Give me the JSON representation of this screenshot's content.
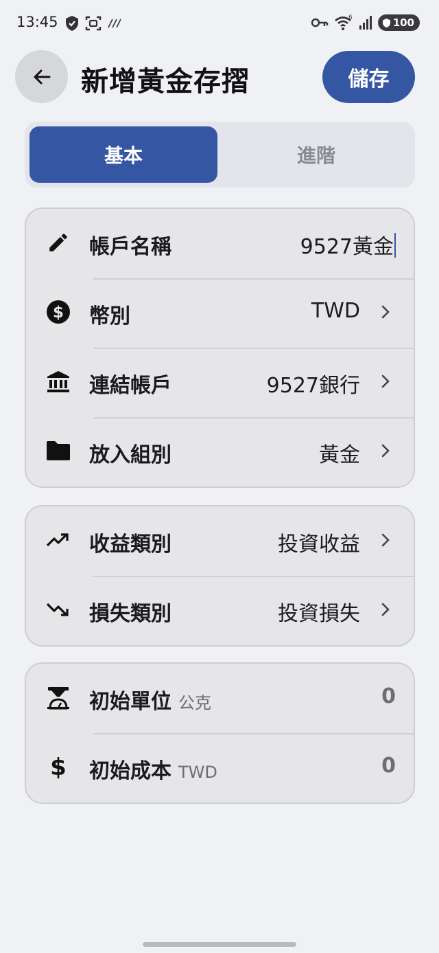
{
  "status_bar": {
    "time": "13:45",
    "battery": "100",
    "wifi_badge": "6"
  },
  "header": {
    "title": "新增黃金存摺",
    "save_label": "儲存"
  },
  "tabs": [
    {
      "label": "基本",
      "active": true
    },
    {
      "label": "進階",
      "active": false
    }
  ],
  "account_section": {
    "name": {
      "label": "帳戶名稱",
      "value": "9527黃金",
      "icon": "pencil-icon"
    },
    "currency": {
      "label": "幣別",
      "value": "TWD",
      "icon": "dollar-circle-icon"
    },
    "linked_account": {
      "label": "連結帳戶",
      "value": "9527銀行",
      "icon": "bank-icon"
    },
    "group": {
      "label": "放入組別",
      "value": "黃金",
      "icon": "folder-icon"
    }
  },
  "category_section": {
    "income": {
      "label": "收益類別",
      "value": "投資收益",
      "icon": "trending-up-icon"
    },
    "loss": {
      "label": "損失類別",
      "value": "投資損失",
      "icon": "trending-down-icon"
    }
  },
  "initial_section": {
    "units": {
      "label": "初始單位",
      "unit": "公克",
      "value": "0",
      "icon": "scale-icon"
    },
    "cost": {
      "label": "初始成本",
      "unit": "TWD",
      "value": "0",
      "icon": "dollar-icon"
    }
  },
  "colors": {
    "accent": "#3556a3",
    "background": "#f0f1f5",
    "card": "#e6e6e9"
  }
}
